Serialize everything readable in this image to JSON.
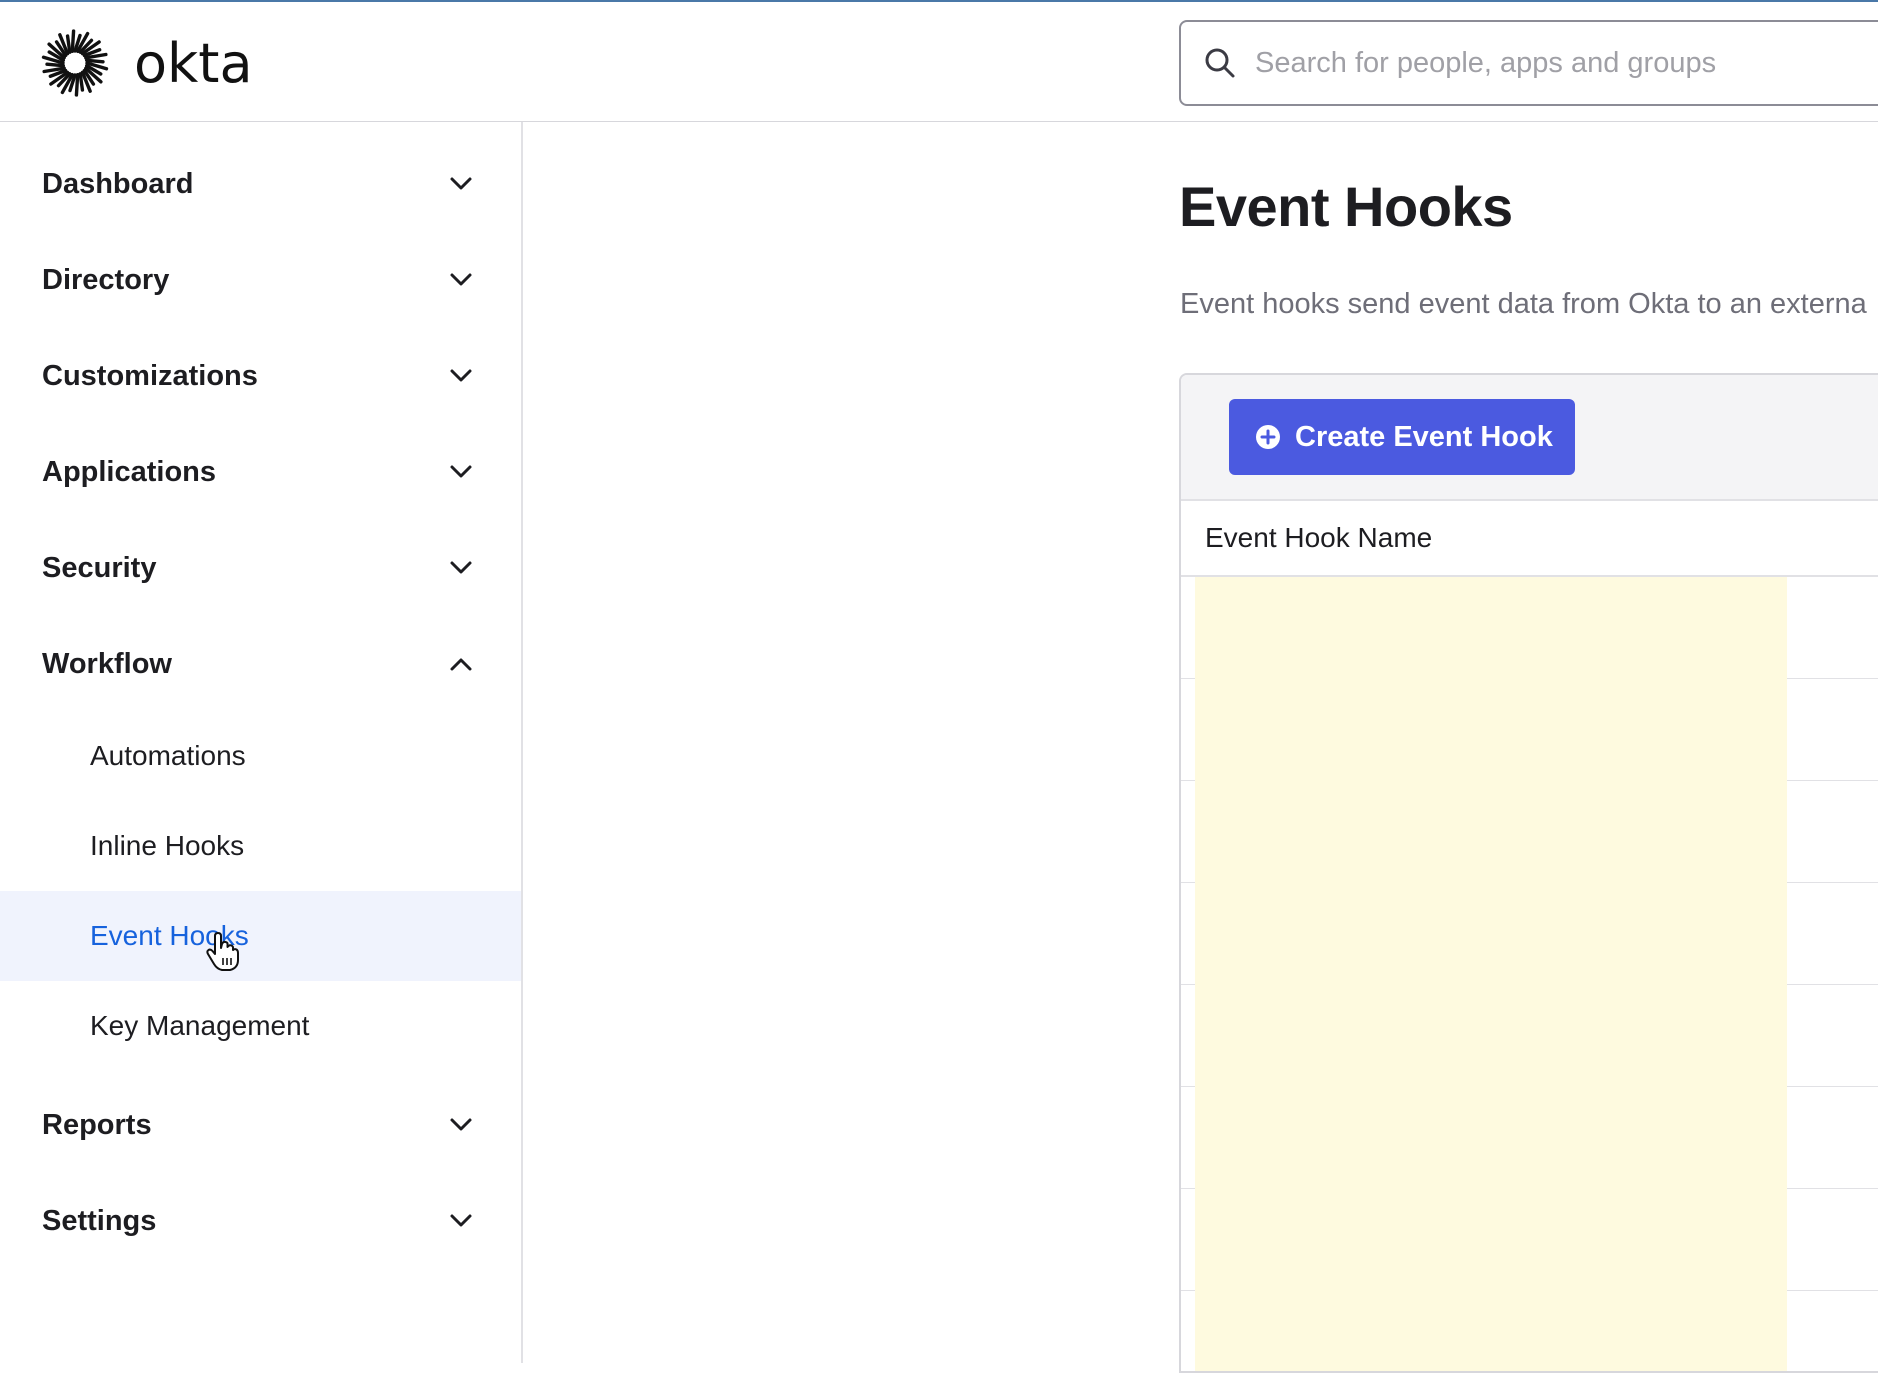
{
  "header": {
    "logo_text": "okta",
    "search": {
      "placeholder": "Search for people, apps and groups",
      "value": ""
    }
  },
  "sidebar": {
    "items": [
      {
        "label": "Dashboard",
        "expanded": false
      },
      {
        "label": "Directory",
        "expanded": false
      },
      {
        "label": "Customizations",
        "expanded": false
      },
      {
        "label": "Applications",
        "expanded": false
      },
      {
        "label": "Security",
        "expanded": false
      },
      {
        "label": "Workflow",
        "expanded": true,
        "children": [
          {
            "label": "Automations"
          },
          {
            "label": "Inline Hooks"
          },
          {
            "label": "Event Hooks",
            "active": true
          },
          {
            "label": "Key Management"
          }
        ]
      },
      {
        "label": "Reports",
        "expanded": false
      },
      {
        "label": "Settings",
        "expanded": false
      }
    ]
  },
  "main": {
    "title": "Event Hooks",
    "description": "Event hooks send event data from Okta to an externa",
    "create_button": "Create Event Hook",
    "table": {
      "columns": [
        "Event Hook Name"
      ],
      "rows": [
        "",
        "",
        "",
        "",
        "",
        "",
        "",
        ""
      ]
    }
  },
  "colors": {
    "accent": "#4b5ae0",
    "active_link": "#1662dd",
    "active_bg": "#f0f3fd",
    "redacted_cell": "#fefadf"
  }
}
